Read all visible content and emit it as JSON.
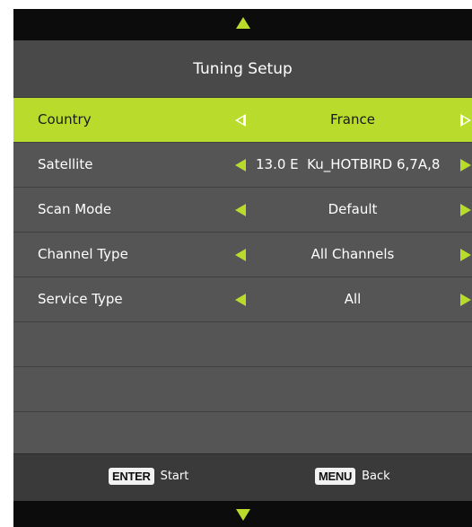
{
  "title": "Tuning Setup",
  "rows": [
    {
      "label": "Country",
      "value": "France",
      "selected": true
    },
    {
      "label": "Satellite",
      "value": "13.0 E  Ku_HOTBIRD 6,7A,8",
      "selected": false
    },
    {
      "label": "Scan Mode",
      "value": "Default",
      "selected": false
    },
    {
      "label": "Channel Type",
      "value": "All Channels",
      "selected": false
    },
    {
      "label": "Service Type",
      "value": "All",
      "selected": false
    }
  ],
  "footer": {
    "enter_key": "ENTER",
    "enter_action": "Start",
    "menu_key": "MENU",
    "menu_action": "Back"
  },
  "colors": {
    "accent": "#b9dc2c",
    "panel": "#555555",
    "background": "#0c0c0c"
  }
}
